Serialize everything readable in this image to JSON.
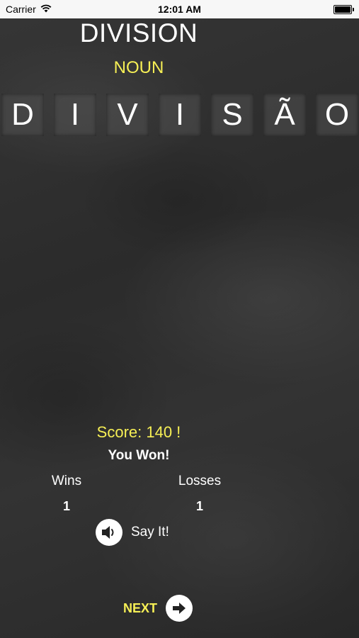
{
  "status_bar": {
    "carrier": "Carrier",
    "time": "12:01 AM"
  },
  "quiz": {
    "english_word": "DIVISION",
    "word_type": "NOUN",
    "answer_letters": [
      "D",
      "I",
      "V",
      "I",
      "S",
      "Ã",
      "O"
    ]
  },
  "result": {
    "score_text": "Score: 140 !",
    "message": "You Won!",
    "wins_label": "Wins",
    "wins_value": "1",
    "losses_label": "Losses",
    "losses_value": "1"
  },
  "actions": {
    "say_it_label": "Say It!",
    "next_label": "NEXT"
  },
  "colors": {
    "accent_yellow": "#f6ef55",
    "text_white": "#ffffff",
    "background": "#2e2e2e"
  },
  "icons": {
    "say_it": "speaker-icon",
    "next": "arrow-right-icon",
    "wifi": "wifi-icon",
    "battery": "battery-icon"
  }
}
